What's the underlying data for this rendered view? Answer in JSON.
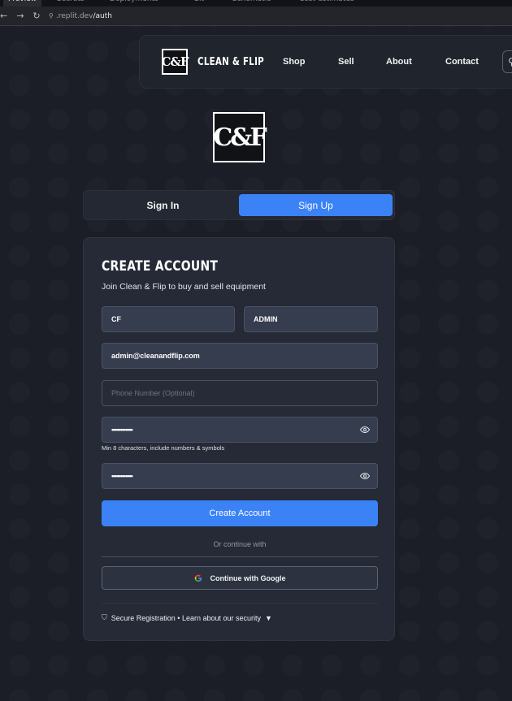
{
  "browser": {
    "tabs": [
      "Preview",
      "Secrets",
      "Deployments",
      "Git",
      "Schematic",
      "Cost-estimates"
    ],
    "url_host": ".replit.dev",
    "url_path": "/auth"
  },
  "header": {
    "logo_text": "C&F",
    "brand": "CLEAN & FLIP",
    "nav": [
      "Shop",
      "Sell",
      "About",
      "Contact"
    ]
  },
  "auth": {
    "logo_text": "C&F",
    "tabs": {
      "signin": "Sign In",
      "signup": "Sign Up",
      "active": "signup"
    },
    "title": "CREATE ACCOUNT",
    "subtitle": "Join Clean & Flip to buy and sell equipment",
    "fields": {
      "first_name": "CF",
      "last_name": "ADMIN",
      "email": "admin@cleanandflip.com",
      "phone_placeholder": "Phone Number (Optional)",
      "password": "••••••••••••",
      "password_hint": "Min 8 characters, include numbers & symbols",
      "confirm_password": "••••••••••••"
    },
    "submit": "Create Account",
    "divider": "Or continue with",
    "google": "Continue with Google",
    "security": "Secure Registration • Learn about our security"
  },
  "colors": {
    "accent": "#3b82f6",
    "card": "#252a36",
    "field": "#353d4e"
  }
}
